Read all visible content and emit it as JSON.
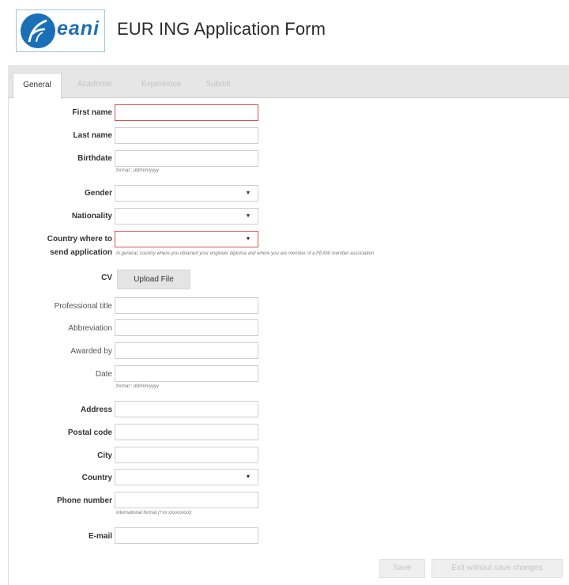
{
  "app": {
    "logo_text": "eani",
    "title": "EUR ING Application Form"
  },
  "tabs": [
    {
      "label": "General",
      "active": true
    },
    {
      "label": "Academic",
      "active": false
    },
    {
      "label": "Experience",
      "active": false
    },
    {
      "label": "Submit",
      "active": false
    }
  ],
  "form": {
    "first_name": {
      "label": "First name",
      "value": ""
    },
    "last_name": {
      "label": "Last name",
      "value": ""
    },
    "birthdate": {
      "label": "Birthdate",
      "value": "",
      "hint": "format : dd/mm/yyyy"
    },
    "gender": {
      "label": "Gender",
      "value": ""
    },
    "nationality": {
      "label": "Nationality",
      "value": ""
    },
    "country_send": {
      "label_line1": "Country where to",
      "label_line2": "send application",
      "value": "",
      "hint": "In general, country where you obtained your engineer diploma and where you are member of a FEANI member association"
    },
    "cv": {
      "label": "CV",
      "button": "Upload File"
    },
    "professional_title": {
      "label": "Professional title",
      "value": ""
    },
    "abbreviation": {
      "label": "Abbreviation",
      "value": ""
    },
    "awarded_by": {
      "label": "Awarded by",
      "value": ""
    },
    "date": {
      "label": "Date",
      "value": "",
      "hint": "format : dd/mm/yyyy"
    },
    "address": {
      "label": "Address",
      "value": ""
    },
    "postal_code": {
      "label": "Postal code",
      "value": ""
    },
    "city": {
      "label": "City",
      "value": ""
    },
    "country": {
      "label": "Country",
      "value": ""
    },
    "phone": {
      "label": "Phone number",
      "value": "",
      "hint": "international format (+xx xxxxxxxxx)"
    },
    "email": {
      "label": "E-mail",
      "value": ""
    }
  },
  "footer": {
    "save": "Save",
    "exit": "Exit without save changes"
  },
  "colors": {
    "error_border": "#d9534f",
    "logo_blue": "#1b6fb6",
    "tabbar_bg": "#e6e6e6"
  }
}
